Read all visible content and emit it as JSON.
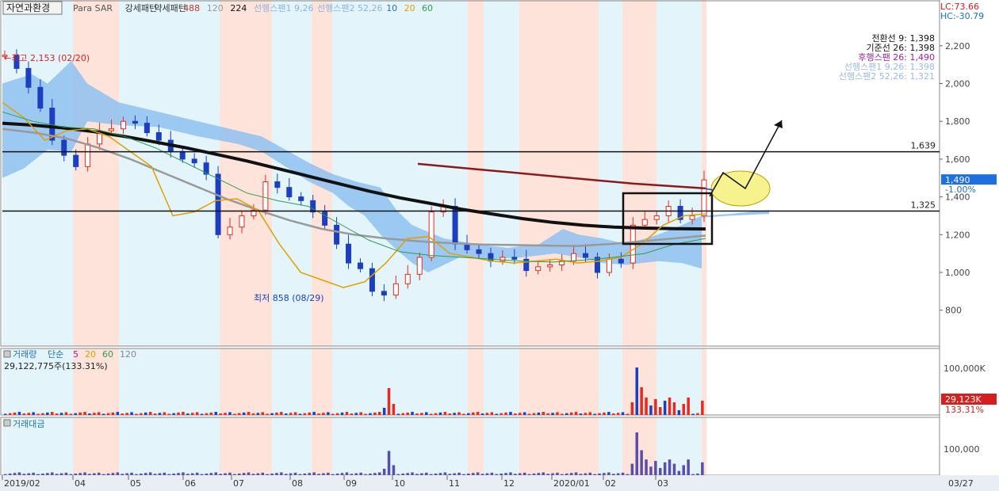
{
  "header": {
    "title_button": "자연과환경",
    "indicators": [
      {
        "text": "Para SAR",
        "color": "#555555"
      },
      {
        "text": "강세패턴",
        "color": "#333333"
      },
      {
        "text": "약세패턴",
        "color": "#333333"
      },
      {
        "text": "488",
        "color": "#c0392b"
      },
      {
        "text": "120",
        "color": "#999999"
      },
      {
        "text": "224",
        "color": "#111111"
      },
      {
        "text": "선행스팬1 9,26",
        "color": "#8ab4e0"
      },
      {
        "text": "선행스팬2 52,26",
        "color": "#8ab4e0"
      },
      {
        "text": "10",
        "color": "#1e6fbf"
      },
      {
        "text": "20",
        "color": "#e0a000"
      },
      {
        "text": "60",
        "color": "#2a9d4b"
      }
    ],
    "lc": "LC:73.66",
    "hc": "HC:-30.79"
  },
  "ichimoku_legend": [
    {
      "text": "전환선 9: 1,398",
      "color": "#111111"
    },
    {
      "text": "기준선 26: 1,398",
      "color": "#111111"
    },
    {
      "text": "후행스팬 26: 1,490",
      "color": "#a020a0"
    },
    {
      "text": "선행스팬1 9,26: 1,398",
      "color": "#9db9e0"
    },
    {
      "text": "선행스팬2 52,26: 1,321",
      "color": "#9db9e0"
    }
  ],
  "price_axis": {
    "ticks": [
      "2,200",
      "2,000",
      "1,800",
      "1,600",
      "1,400",
      "1,200",
      "1,000",
      "800"
    ]
  },
  "annotations": {
    "high": "←최고 2,153 (02/20)",
    "low": "최저 858 (08/29)",
    "line_upper": "1,639",
    "line_lower": "1,325",
    "current_price": "1,490",
    "current_change": "-1.00%"
  },
  "volume_panel": {
    "title_parts": [
      {
        "text": "거래량",
        "color": "#1e6fbf"
      },
      {
        "text": "단순",
        "color": "#1e6fbf"
      },
      {
        "text": "5",
        "color": "#a020a0"
      },
      {
        "text": "20",
        "color": "#e0a000"
      },
      {
        "text": "60",
        "color": "#2a9d4b"
      },
      {
        "text": "120",
        "color": "#888888"
      }
    ],
    "value": "29,122,775주(133.31%)",
    "axis_tick": "100,000K",
    "current_value": "29,123K",
    "current_pct": "133.31%"
  },
  "amount_panel": {
    "title": "거래대금",
    "axis_tick": "100,000"
  },
  "x_axis": {
    "labels": [
      "2019/02",
      "04",
      "05",
      "06",
      "07",
      "08",
      "09",
      "10",
      "11",
      "12",
      "2020/01",
      "02",
      "03"
    ],
    "last_date": "03/27"
  },
  "colors": {
    "up": "#e8291f",
    "down": "#1c3fbf",
    "cloud": "#8fc1f0",
    "ma224": "#111111",
    "ma120": "#999999",
    "ma488": "#8b1a1a",
    "blue_band": "#e3f5fb",
    "pink_band": "#fde3da"
  },
  "chart_data": {
    "type": "candlestick",
    "title": "자연과환경",
    "x_start": "2019/02",
    "x_end": "2020/03/27",
    "y_range": [
      650,
      2300
    ],
    "horizontal_lines": [
      1639,
      1325
    ],
    "high": {
      "value": 2153,
      "date": "02/20"
    },
    "low": {
      "value": 858,
      "date": "08/29"
    },
    "last_close": 1490,
    "close_series": [
      2150,
      2080,
      1980,
      1870,
      1700,
      1620,
      1560,
      1680,
      1750,
      1760,
      1800,
      1790,
      1740,
      1700,
      1640,
      1600,
      1580,
      1520,
      1200,
      1240,
      1300,
      1330,
      1480,
      1450,
      1400,
      1380,
      1320,
      1250,
      1150,
      1050,
      1020,
      900,
      880,
      940,
      990,
      1080,
      1320,
      1350,
      1150,
      1120,
      1100,
      1060,
      1080,
      1070,
      1010,
      1030,
      1040,
      1060,
      1100,
      1080,
      1000,
      1070,
      1050,
      1250,
      1280,
      1300,
      1350,
      1280,
      1300,
      1490
    ],
    "ma224_series": [
      1790,
      1780,
      1765,
      1745,
      1720,
      1690,
      1660,
      1625,
      1590,
      1550,
      1510,
      1470,
      1430,
      1395,
      1365,
      1335,
      1310,
      1285,
      1265,
      1250,
      1240,
      1235,
      1232,
      1230
    ],
    "ma120_series": [
      1760,
      1740,
      1710,
      1660,
      1600,
      1530,
      1460,
      1390,
      1330,
      1275,
      1230,
      1200,
      1180,
      1165,
      1155,
      1148,
      1145,
      1142,
      1140,
      1150,
      1165,
      1180,
      1195
    ],
    "ma488_series": [
      1575,
      1540,
      1505,
      1470,
      1445
    ],
    "volume_peak": "100,000K",
    "volume_last": "29,123K"
  }
}
